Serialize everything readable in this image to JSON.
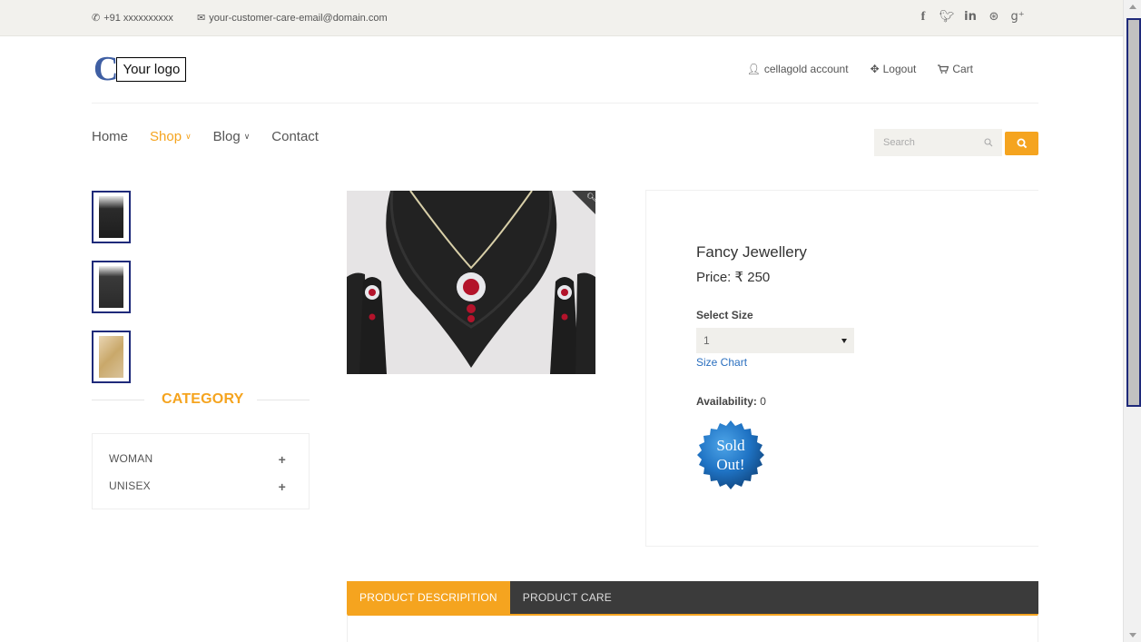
{
  "topbar": {
    "phone": "+91 xxxxxxxxxx",
    "email": "your-customer-care-email@domain.com",
    "social": [
      {
        "name": "facebook-icon",
        "glyph": "f"
      },
      {
        "name": "twitter-icon",
        "glyph": "🐦"
      },
      {
        "name": "linkedin-icon",
        "glyph": "in"
      },
      {
        "name": "dribbble-icon",
        "glyph": "⊛"
      },
      {
        "name": "google-plus-icon",
        "glyph": "g⁺"
      }
    ]
  },
  "header": {
    "logo_mark": "C",
    "logo_text": "Your logo",
    "account": "cellagold account",
    "logout": "Logout",
    "cart": "Cart"
  },
  "nav": {
    "items": [
      "Home",
      "Shop",
      "Blog",
      "Contact"
    ],
    "search_placeholder": "Search"
  },
  "category": {
    "heading": "CATEGORY",
    "items": [
      "WOMAN",
      "UNISEX"
    ]
  },
  "product": {
    "title": "Fancy Jewellery",
    "price": "Price: ₹ 250",
    "size_label": "Select Size",
    "size_value": "1",
    "size_chart": "Size Chart",
    "availability_label": "Availability:",
    "availability_value": "0",
    "badge_line1": "Sold",
    "badge_line2": "Out!"
  },
  "tabs": {
    "items": [
      "PRODUCT DESCRIPITION",
      "PRODUCT CARE"
    ]
  },
  "colors": {
    "accent": "#f5a41f",
    "tab_bar": "#3b3b3b",
    "thumb_border": "#1f2a7a",
    "badge": "#1f73c4"
  }
}
